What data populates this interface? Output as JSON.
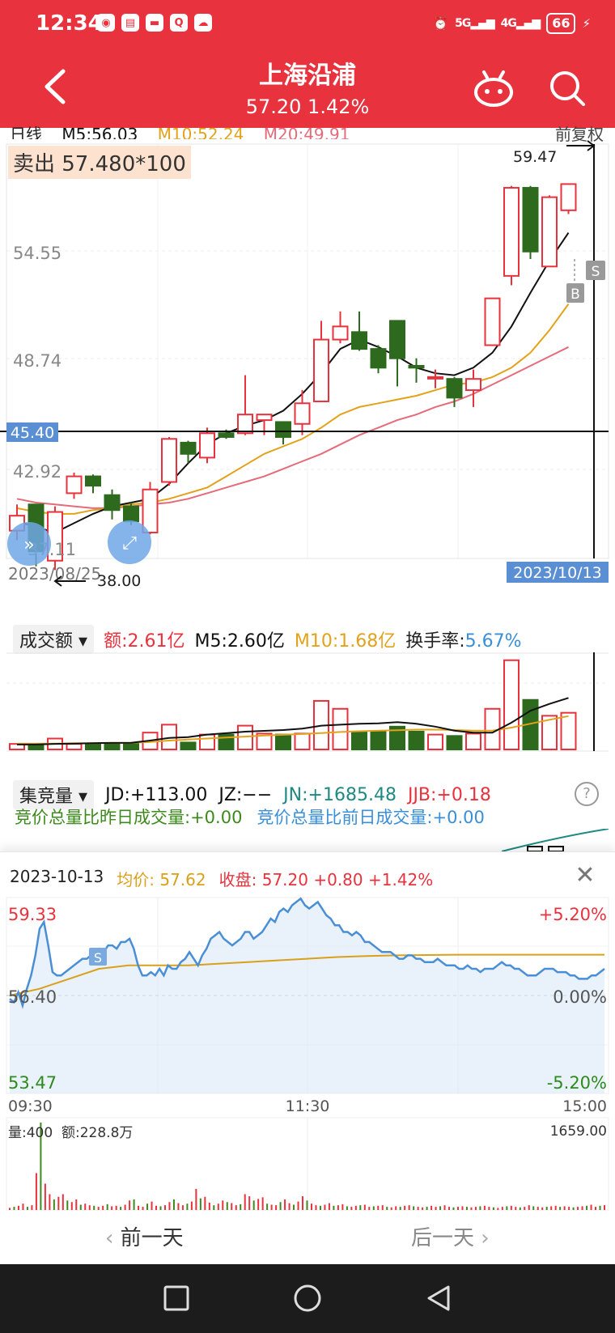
{
  "status_bar": {
    "time": "12:34",
    "battery": "66",
    "net1": "5G",
    "net2": "4G"
  },
  "header": {
    "title": "上海沿浦",
    "price": "57.20",
    "change_pct": "1.42%"
  },
  "ma_row": {
    "label": "日线",
    "m5": "M5:56.03",
    "m10": "M10:52.24",
    "m20": "M20:49.91",
    "adjust": "前复权"
  },
  "sell_badge": "卖出 57.480*100",
  "price_axis": {
    "p1": "54.55",
    "p2": "48.74",
    "p3": "42.92",
    "p4": "37.11",
    "crosshair": "45.40"
  },
  "annotations": {
    "high": "59.47",
    "low": "38.00",
    "start_date": "2023/08/25",
    "end_date": "2023/10/13",
    "s_marker": "S",
    "b_marker": "B"
  },
  "colors": {
    "up": "#e8323e",
    "down": "#2d6a1e",
    "m5": "#111111",
    "m10": "#e2a21a",
    "m20": "#e56b7a",
    "header": "#e8323e"
  },
  "chart_data": {
    "type": "candlestick",
    "candles": [
      {
        "o": 40.1,
        "c": 40.9,
        "h": 41.5,
        "l": 39.6
      },
      {
        "o": 41.5,
        "c": 39.0,
        "h": 41.5,
        "l": 38.2
      },
      {
        "o": 38.5,
        "c": 41.1,
        "h": 41.4,
        "l": 38.0
      },
      {
        "o": 42.1,
        "c": 43.0,
        "h": 43.2,
        "l": 41.8
      },
      {
        "o": 43.0,
        "c": 42.5,
        "h": 43.1,
        "l": 42.1
      },
      {
        "o": 42.0,
        "c": 41.2,
        "h": 42.3,
        "l": 40.7
      },
      {
        "o": 41.4,
        "c": 40.6,
        "h": 41.6,
        "l": 40.4
      },
      {
        "o": 40.0,
        "c": 42.3,
        "h": 42.7,
        "l": 39.9
      },
      {
        "o": 42.7,
        "c": 45.0,
        "h": 45.1,
        "l": 42.5
      },
      {
        "o": 44.8,
        "c": 44.2,
        "h": 44.9,
        "l": 43.7
      },
      {
        "o": 44.0,
        "c": 45.3,
        "h": 45.6,
        "l": 43.7
      },
      {
        "o": 45.3,
        "c": 45.1,
        "h": 45.5,
        "l": 45.0
      },
      {
        "o": 45.3,
        "c": 46.3,
        "h": 48.4,
        "l": 45.2
      },
      {
        "o": 46.0,
        "c": 46.3,
        "h": 46.3,
        "l": 45.2
      },
      {
        "o": 45.9,
        "c": 45.1,
        "h": 45.9,
        "l": 44.7
      },
      {
        "o": 45.8,
        "c": 46.9,
        "h": 47.6,
        "l": 45.2
      },
      {
        "o": 47.0,
        "c": 50.3,
        "h": 51.3,
        "l": 47.0
      },
      {
        "o": 50.3,
        "c": 51.0,
        "h": 51.8,
        "l": 50.1
      },
      {
        "o": 50.7,
        "c": 49.8,
        "h": 51.8,
        "l": 49.7
      },
      {
        "o": 49.8,
        "c": 48.8,
        "h": 50.0,
        "l": 48.5
      },
      {
        "o": 51.3,
        "c": 49.3,
        "h": 51.3,
        "l": 47.8
      },
      {
        "o": 48.9,
        "c": 48.8,
        "h": 49.3,
        "l": 48.0
      },
      {
        "o": 48.3,
        "c": 48.3,
        "h": 48.7,
        "l": 47.7
      },
      {
        "o": 48.2,
        "c": 47.2,
        "h": 48.3,
        "l": 46.7
      },
      {
        "o": 47.6,
        "c": 48.2,
        "h": 48.7,
        "l": 46.7
      },
      {
        "o": 50.0,
        "c": 52.5,
        "h": 52.5,
        "l": 50.0
      },
      {
        "o": 53.7,
        "c": 58.4,
        "h": 58.5,
        "l": 53.2
      },
      {
        "o": 58.4,
        "c": 55.0,
        "h": 58.5,
        "l": 54.6
      },
      {
        "o": 54.2,
        "c": 57.9,
        "h": 58.0,
        "l": 54.2
      },
      {
        "o": 57.2,
        "c": 58.6,
        "h": 58.6,
        "l": 57.0
      }
    ],
    "ma5": [
      40.6,
      40.3,
      40.0,
      40.5,
      41.0,
      41.4,
      41.6,
      41.8,
      42.6,
      43.7,
      44.7,
      45.3,
      45.7,
      46.0,
      46.5,
      47.4,
      48.5,
      49.8,
      50.3,
      49.9,
      49.4,
      48.8,
      48.5,
      48.4,
      48.8,
      49.6,
      51.0,
      52.8,
      54.5,
      56.0
    ],
    "ma10": [
      41.3,
      41.1,
      41.0,
      41.0,
      41.2,
      41.3,
      41.5,
      41.6,
      41.8,
      42.1,
      42.4,
      43.0,
      43.6,
      44.2,
      44.6,
      45.0,
      45.6,
      46.3,
      46.7,
      46.9,
      47.1,
      47.3,
      47.6,
      47.9,
      48.0,
      48.3,
      48.8,
      49.6,
      50.8,
      52.2
    ],
    "ma20": [
      41.8,
      41.6,
      41.5,
      41.4,
      41.3,
      41.3,
      41.4,
      41.5,
      41.6,
      41.8,
      42.1,
      42.4,
      42.7,
      43.0,
      43.4,
      43.8,
      44.2,
      44.7,
      45.2,
      45.6,
      46.0,
      46.3,
      46.7,
      47.0,
      47.4,
      47.9,
      48.4,
      48.9,
      49.4,
      49.9
    ],
    "volume": [
      0.28,
      0.28,
      0.55,
      0.28,
      0.28,
      0.28,
      0.28,
      0.85,
      1.25,
      0.35,
      0.75,
      0.75,
      1.2,
      0.8,
      0.75,
      0.8,
      2.45,
      2.05,
      0.9,
      0.9,
      1.15,
      0.9,
      0.75,
      0.68,
      0.8,
      2.05,
      4.5,
      2.5,
      1.7,
      1.85
    ],
    "vol_ma5": [
      0.25,
      0.25,
      0.28,
      0.3,
      0.32,
      0.33,
      0.34,
      0.45,
      0.58,
      0.62,
      0.75,
      0.82,
      0.9,
      0.94,
      0.98,
      1.05,
      1.2,
      1.25,
      1.3,
      1.32,
      1.38,
      1.3,
      1.15,
      0.95,
      0.85,
      0.85,
      1.35,
      1.95,
      2.3,
      2.6
    ],
    "vol_ma10": [
      0.3,
      0.3,
      0.3,
      0.31,
      0.32,
      0.33,
      0.34,
      0.38,
      0.45,
      0.5,
      0.55,
      0.6,
      0.65,
      0.7,
      0.74,
      0.78,
      0.83,
      0.88,
      0.92,
      0.95,
      0.97,
      1.0,
      1.0,
      0.98,
      0.95,
      0.95,
      1.1,
      1.3,
      1.5,
      1.68
    ]
  },
  "volume_panel": {
    "selector": "成交额",
    "amount": "额:2.61亿",
    "m5": "M5:2.60亿",
    "m10": "M10:1.68亿",
    "turnover_label": "换手率:",
    "turnover_value": "5.67%"
  },
  "auction_panel": {
    "selector": "集竞量",
    "jd": "JD:+113.00",
    "jz": "JZ:−−",
    "jn": "JN:+1685.48",
    "jjb": "JJB:+0.18",
    "row2_a": "竞价总量比昨日成交量:+0.00",
    "row2_b": "竞价总量比前日成交量:+0.00"
  },
  "intraday": {
    "date": "2023-10-13",
    "avg_label": "均价:",
    "avg_value": "57.62",
    "close_label": "收盘:",
    "close_value": "57.20 +0.80 +1.42%",
    "y_high": "59.33",
    "y_mid": "56.40",
    "y_low": "53.47",
    "pct_high": "+5.20%",
    "pct_mid": "0.00%",
    "pct_low": "-5.20%",
    "t_start": "09:30",
    "t_mid": "11:30",
    "t_end": "15:00",
    "s_marker": "S",
    "vol_label": "量:400",
    "amt_label": "额:228.8万",
    "vol_max": "1659.00",
    "prev_day": "前一天",
    "next_day": "后一天",
    "price_series": [
      56.3,
      56.2,
      56.5,
      56.1,
      56.6,
      57.0,
      57.6,
      58.4,
      58.6,
      57.9,
      57.1,
      57.0,
      57.0,
      57.1,
      57.2,
      57.3,
      57.4,
      57.5,
      57.5,
      57.6,
      57.7,
      57.8,
      57.7,
      57.9,
      57.9,
      57.8,
      58.0,
      58.0,
      58.1,
      57.8,
      57.3,
      57.0,
      57.0,
      57.1,
      57.0,
      57.2,
      57.0,
      57.3,
      57.2,
      57.2,
      57.4,
      57.5,
      57.7,
      57.5,
      57.3,
      57.6,
      57.8,
      58.1,
      58.2,
      58.3,
      58.1,
      58.0,
      57.9,
      58.0,
      58.1,
      58.3,
      58.3,
      58.1,
      58.2,
      58.3,
      58.5,
      58.7,
      58.6,
      58.9,
      59.0,
      58.9,
      59.1,
      59.2,
      59.3,
      59.1,
      59.0,
      59.1,
      59.2,
      59.0,
      58.8,
      58.7,
      58.5,
      58.5,
      58.3,
      58.3,
      58.2,
      58.3,
      58.2,
      58.0,
      58.0,
      57.9,
      57.8,
      57.7,
      57.7,
      57.7,
      57.6,
      57.5,
      57.5,
      57.6,
      57.6,
      57.5,
      57.5,
      57.4,
      57.4,
      57.4,
      57.5,
      57.4,
      57.3,
      57.3,
      57.3,
      57.2,
      57.2,
      57.3,
      57.2,
      57.2,
      57.1,
      57.2,
      57.2,
      57.2,
      57.3,
      57.4,
      57.3,
      57.3,
      57.2,
      57.2,
      57.1,
      57.0,
      57.0,
      57.0,
      57.1,
      57.2,
      57.2,
      57.2,
      57.1,
      57.1,
      57.1,
      57.0,
      57.0,
      56.9,
      56.9,
      56.9,
      57.0,
      57.0,
      57.1,
      57.2
    ],
    "avg_series": [
      56.4,
      56.6,
      56.9,
      57.2,
      57.3,
      57.3,
      57.3,
      57.35,
      57.4,
      57.45,
      57.5,
      57.55,
      57.58,
      57.6,
      57.61,
      57.62,
      57.62,
      57.62,
      57.62,
      57.62,
      57.62
    ],
    "vol_series": [
      40,
      60,
      80,
      120,
      60,
      90,
      700,
      1659,
      500,
      300,
      200,
      250,
      300,
      180,
      150,
      200,
      100,
      120,
      90,
      80,
      60,
      80,
      110,
      70,
      80,
      60,
      100,
      180,
      200,
      80,
      60,
      120,
      160,
      80,
      70,
      90,
      150,
      200,
      130,
      90,
      120,
      160,
      400,
      220,
      250,
      140,
      90,
      120,
      180,
      150,
      130,
      90,
      110,
      300,
      260,
      180,
      210,
      240,
      120,
      100,
      90,
      150,
      200,
      130,
      100,
      160,
      260,
      180,
      120,
      90,
      80,
      100,
      130,
      80,
      90,
      110,
      70,
      60,
      80,
      90,
      100,
      60,
      70,
      80,
      90,
      60,
      50,
      70,
      60,
      80,
      90,
      70,
      60,
      50,
      60,
      80,
      60,
      70,
      90,
      60,
      50,
      60,
      70,
      60,
      50,
      60,
      70,
      80,
      60,
      50,
      40,
      60,
      70,
      80,
      60,
      50,
      60,
      90,
      70,
      60,
      50,
      60,
      70,
      80,
      60,
      70,
      60,
      50,
      60,
      70,
      80,
      100,
      60,
      80,
      90
    ]
  }
}
